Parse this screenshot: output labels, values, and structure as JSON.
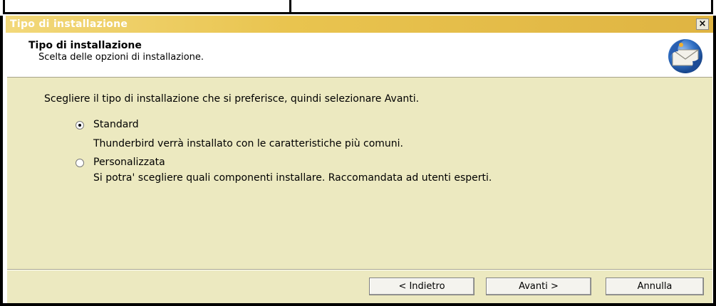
{
  "window": {
    "title": "Tipo di installazione",
    "close_glyph": "×"
  },
  "header": {
    "title": "Tipo di installazione",
    "subtitle": "Scelta delle opzioni di installazione.",
    "logo_icon": "thunderbird-logo"
  },
  "main": {
    "instruction": "Scegliere il tipo di installazione che si preferisce, quindi selezionare Avanti.",
    "options": [
      {
        "label": "Standard",
        "description": "Thunderbird verrà installato con le caratteristiche più comuni.",
        "selected": true
      },
      {
        "label": "Personalizzata",
        "description": "Si potra' scegliere quali componenti installare. Raccomandata ad utenti esperti.",
        "selected": false
      }
    ]
  },
  "footer": {
    "back": "< Indietro",
    "next": "Avanti >",
    "cancel": "Annulla"
  },
  "colors": {
    "title_bar": "#e9c44f",
    "body_bg": "#ece9c0",
    "header_bg": "#ffffff"
  }
}
